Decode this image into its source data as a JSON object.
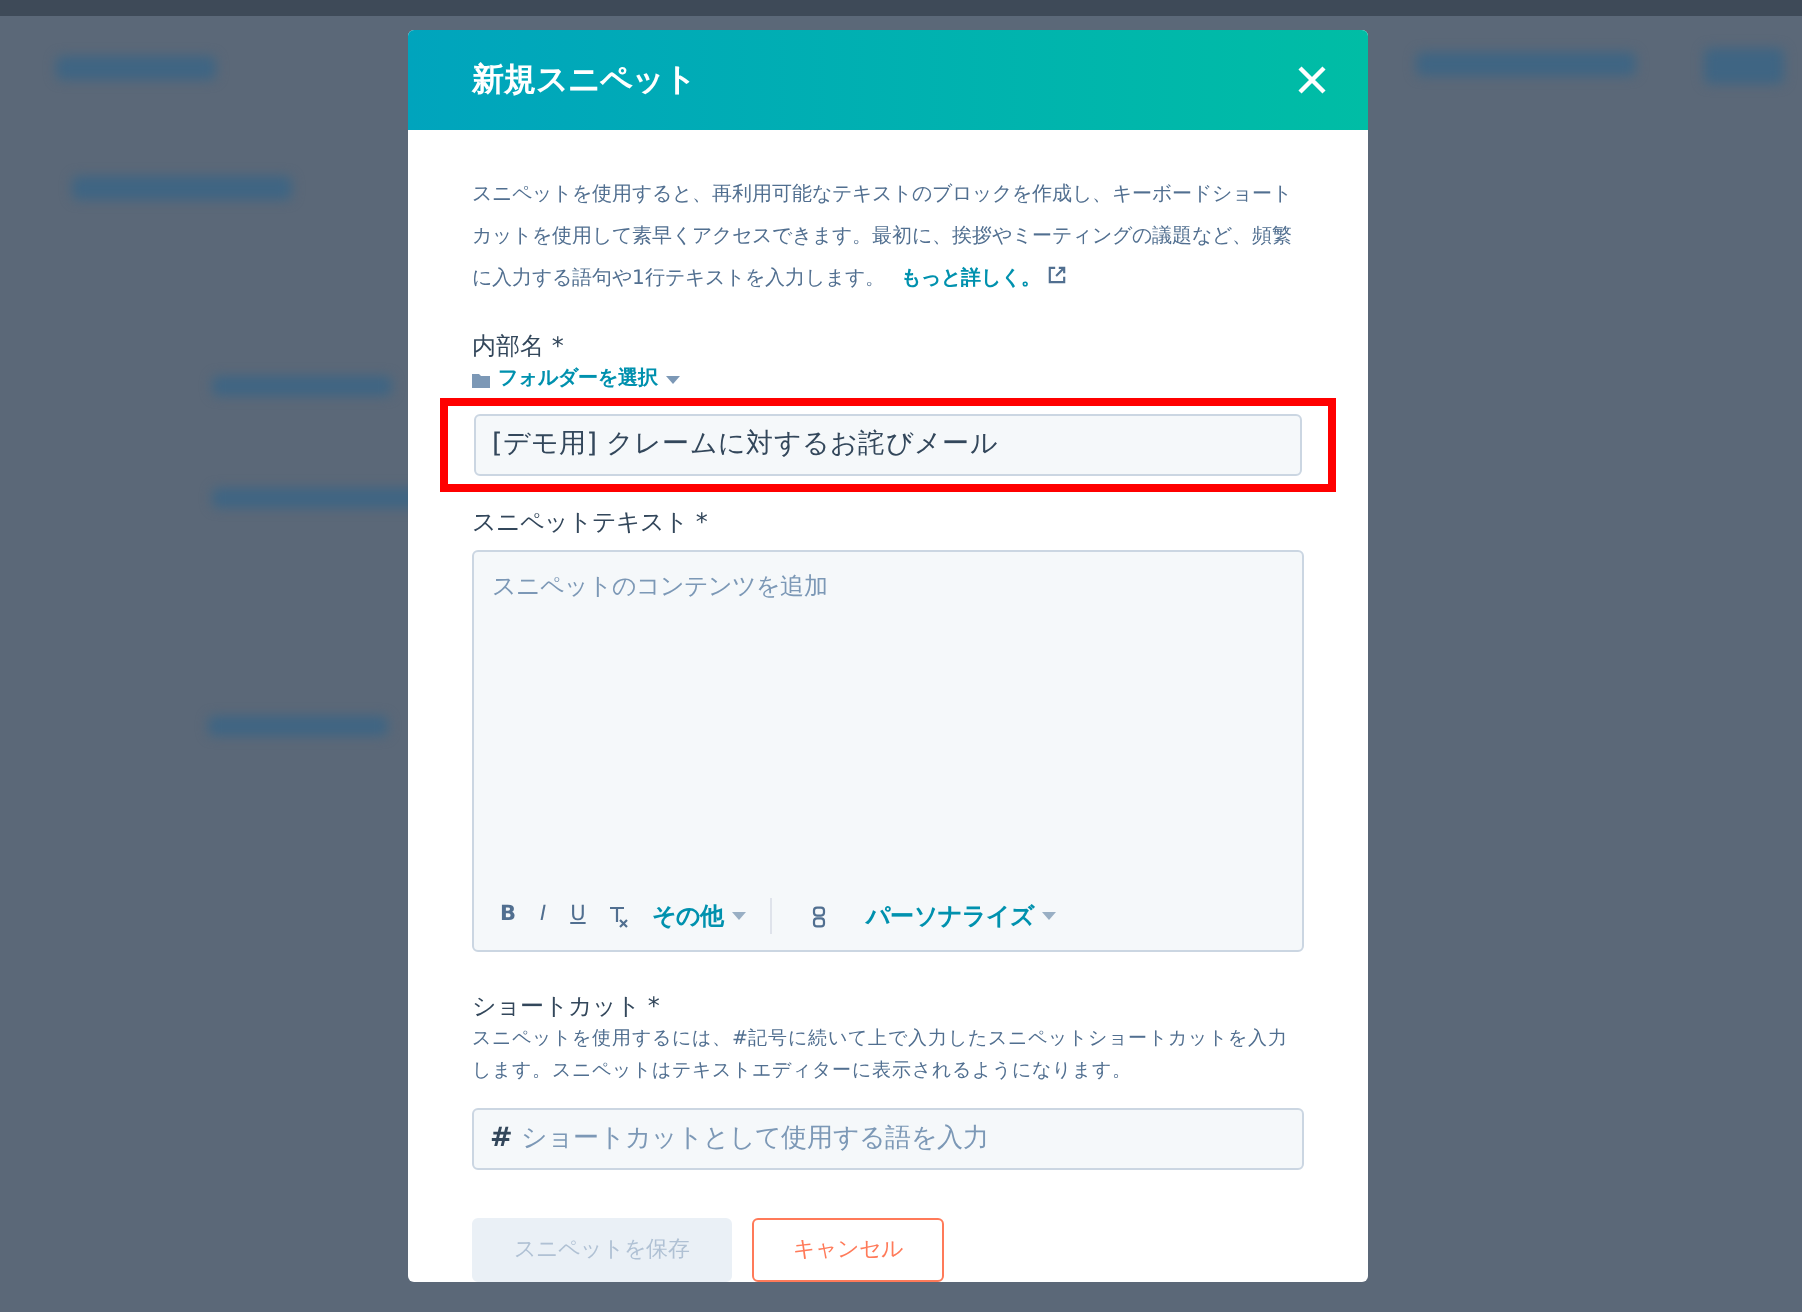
{
  "modal": {
    "title": "新規スニペット",
    "intro": "スニペットを使用すると、再利用可能なテキストのブロックを作成し、キーボードショートカットを使用して素早くアクセスできます。最初に、挨拶やミーティングの議題など、頻繁に入力する語句や1行テキストを入力します。",
    "learn_more": "もっと詳しく。",
    "name_field": {
      "label": "内部名 *",
      "folder": "フォルダーを選択",
      "value": "[デモ用] クレームに対するお詫びメール",
      "highlighted": true
    },
    "text_field": {
      "label": "スニペットテキスト *",
      "placeholder": "スニペットのコンテンツを追加",
      "toolbar": [
        {
          "kind": "bold",
          "text": "B"
        },
        {
          "kind": "italic",
          "text": "I"
        },
        {
          "kind": "underline",
          "text": "U"
        },
        {
          "kind": "clear"
        },
        {
          "kind": "menu",
          "text": "その他"
        },
        {
          "kind": "divider"
        },
        {
          "kind": "link"
        },
        {
          "kind": "menu",
          "text": "パーソナライズ"
        }
      ]
    },
    "shortcut_field": {
      "label": "ショートカット *",
      "help": "スニペットを使用するには、#記号に続いて上で入力したスニペットショートカットを入力します。スニペットはテキストエディターに表示されるようになります。",
      "prefix": "#",
      "placeholder": "ショートカットとして使用する語を入力"
    },
    "buttons": [
      {
        "label": "スニペットを保存",
        "kind": "primary",
        "disabled": true
      },
      {
        "label": "キャンセル",
        "kind": "secondary",
        "disabled": false
      }
    ]
  }
}
